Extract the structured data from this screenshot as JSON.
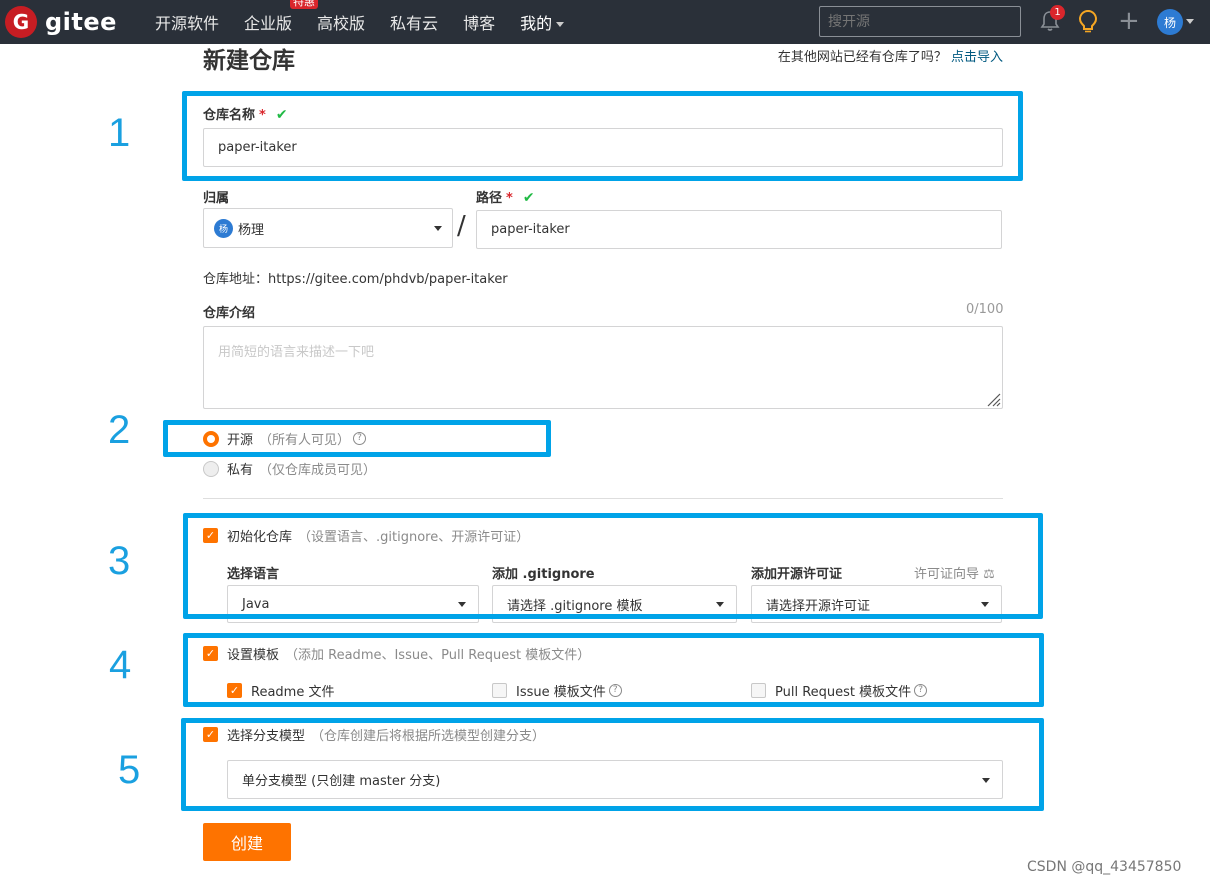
{
  "header": {
    "logo_text": "gitee",
    "logo_letter": "G",
    "nav": [
      "开源软件",
      "企业版",
      "高校版",
      "私有云",
      "博客",
      "我的"
    ],
    "nav_badge": "特惠",
    "search_placeholder": "搜开源",
    "notification_count": "1",
    "user_avatar": "杨"
  },
  "page": {
    "title": "新建仓库",
    "import_prompt": "在其他网站已经有仓库了吗？",
    "import_link": "点击导入"
  },
  "form": {
    "repo_name_label": "仓库名称",
    "required_mark": "*",
    "valid_mark": "✔",
    "repo_name_value": "paper-itaker",
    "owner_label": "归属",
    "owner_avatar": "杨",
    "owner_value": "杨理",
    "slash": "/",
    "path_label": "路径",
    "path_value": "paper-itaker",
    "repo_url": "仓库地址：https://gitee.com/phdvb/paper-itaker",
    "desc_label": "仓库介绍",
    "desc_counter": "0/100",
    "desc_placeholder": "用简短的语言来描述一下吧",
    "visibility": {
      "public_label": "开源",
      "public_hint": "（所有人可见）",
      "private_label": "私有",
      "private_hint": "（仅仓库成员可见）"
    },
    "init": {
      "label": "初始化仓库",
      "hint": "（设置语言、.gitignore、开源许可证）",
      "lang_label": "选择语言",
      "lang_value": "Java",
      "gitignore_label": "添加 .gitignore",
      "gitignore_value": "请选择 .gitignore 模板",
      "license_label": "添加开源许可证",
      "license_guide": "许可证向导",
      "license_value": "请选择开源许可证"
    },
    "template": {
      "label": "设置模板",
      "hint": "（添加 Readme、Issue、Pull Request 模板文件）",
      "readme": "Readme 文件",
      "issue": "Issue 模板文件",
      "pr": "Pull Request 模板文件"
    },
    "branch": {
      "label": "选择分支模型",
      "hint": "（仓库创建后将根据所选模型创建分支）",
      "value": "单分支模型 (只创建 master 分支)"
    },
    "create_button": "创建"
  },
  "annotations": [
    "1",
    "2",
    "3",
    "4",
    "5"
  ],
  "watermark": "CSDN @qq_43457850",
  "colors": {
    "accent": "#fe7300",
    "header_bg": "#2a3039",
    "annotation": "#00a3e8",
    "valid": "#21ba45"
  }
}
